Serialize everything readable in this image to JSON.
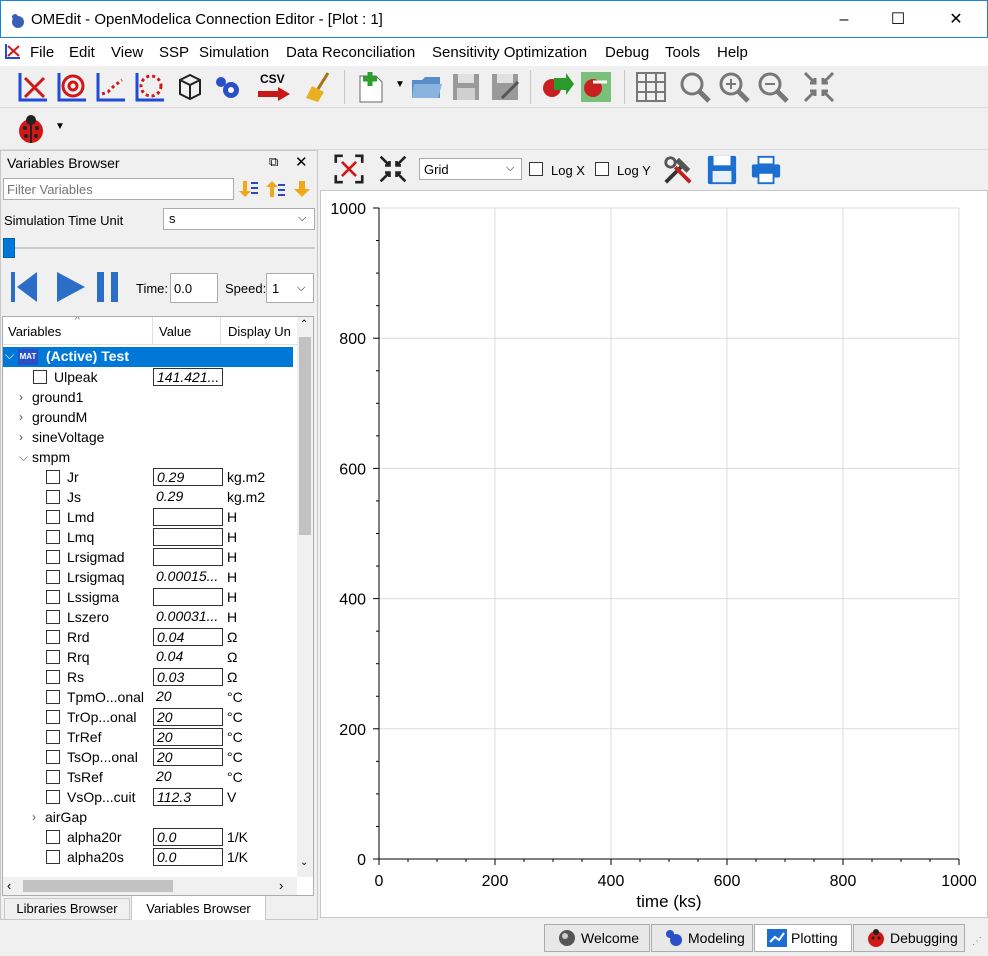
{
  "window": {
    "title": "OMEdit - OpenModelica Connection Editor - [Plot : 1]",
    "minimize": "–",
    "maximize": "☐",
    "close": "✕"
  },
  "menu": [
    "File",
    "Edit",
    "View",
    "SSP",
    "Simulation",
    "Data Reconciliation",
    "Sensitivity Optimization",
    "Debug",
    "Tools",
    "Help"
  ],
  "toolbar": {
    "csv_label": "CSV"
  },
  "variables_browser": {
    "title": "Variables Browser",
    "filter_placeholder": "Filter Variables",
    "sim_time_unit_label": "Simulation Time Unit",
    "sim_time_unit_value": "s",
    "time_label": "Time:",
    "time_value": "0.0",
    "speed_label": "Speed:",
    "speed_value": "1",
    "columns": [
      "Variables",
      "Value",
      "Display Un"
    ],
    "root": "(Active) Test",
    "root_badge": "MAT",
    "rows": [
      {
        "label": "Ulpeak",
        "value": "141.421...",
        "unit": "",
        "indent": 1,
        "type": "var",
        "boxed": true
      },
      {
        "label": "ground1",
        "indent": 1,
        "type": "group",
        "open": false
      },
      {
        "label": "groundM",
        "indent": 1,
        "type": "group",
        "open": false
      },
      {
        "label": "sineVoltage",
        "indent": 1,
        "type": "group",
        "open": false
      },
      {
        "label": "smpm",
        "indent": 1,
        "type": "group",
        "open": true
      },
      {
        "label": "Jr",
        "value": "0.29",
        "unit": "kg.m2",
        "indent": 2,
        "type": "var",
        "boxed": true
      },
      {
        "label": "Js",
        "value": "0.29",
        "unit": "kg.m2",
        "indent": 2,
        "type": "var",
        "boxed": false
      },
      {
        "label": "Lmd",
        "value": "",
        "unit": "H",
        "indent": 2,
        "type": "var",
        "boxed": true
      },
      {
        "label": "Lmq",
        "value": "",
        "unit": "H",
        "indent": 2,
        "type": "var",
        "boxed": true
      },
      {
        "label": "Lrsigmad",
        "value": "",
        "unit": "H",
        "indent": 2,
        "type": "var",
        "boxed": true
      },
      {
        "label": "Lrsigmaq",
        "value": "0.00015...",
        "unit": "H",
        "indent": 2,
        "type": "var",
        "boxed": false
      },
      {
        "label": "Lssigma",
        "value": "",
        "unit": "H",
        "indent": 2,
        "type": "var",
        "boxed": true
      },
      {
        "label": "Lszero",
        "value": "0.00031...",
        "unit": "H",
        "indent": 2,
        "type": "var",
        "boxed": false
      },
      {
        "label": "Rrd",
        "value": "0.04",
        "unit": "Ω",
        "indent": 2,
        "type": "var",
        "boxed": true
      },
      {
        "label": "Rrq",
        "value": "0.04",
        "unit": "Ω",
        "indent": 2,
        "type": "var",
        "boxed": false
      },
      {
        "label": "Rs",
        "value": "0.03",
        "unit": "Ω",
        "indent": 2,
        "type": "var",
        "boxed": true
      },
      {
        "label": "TpmO...onal",
        "value": "20",
        "unit": "°C",
        "indent": 2,
        "type": "var",
        "boxed": false
      },
      {
        "label": "TrOp...onal",
        "value": "20",
        "unit": "°C",
        "indent": 2,
        "type": "var",
        "boxed": true
      },
      {
        "label": "TrRef",
        "value": "20",
        "unit": "°C",
        "indent": 2,
        "type": "var",
        "boxed": true
      },
      {
        "label": "TsOp...onal",
        "value": "20",
        "unit": "°C",
        "indent": 2,
        "type": "var",
        "boxed": true
      },
      {
        "label": "TsRef",
        "value": "20",
        "unit": "°C",
        "indent": 2,
        "type": "var",
        "boxed": false
      },
      {
        "label": "VsOp...cuit",
        "value": "112.3",
        "unit": "V",
        "indent": 2,
        "type": "var",
        "boxed": true
      },
      {
        "label": "airGap",
        "indent": 2,
        "type": "group",
        "open": false
      },
      {
        "label": "alpha20r",
        "value": "0.0",
        "unit": "1/K",
        "indent": 2,
        "type": "var",
        "boxed": true
      },
      {
        "label": "alpha20s",
        "value": "0.0",
        "unit": "1/K",
        "indent": 2,
        "type": "var",
        "boxed": true
      }
    ]
  },
  "bottom_tabs_left": [
    "Libraries Browser",
    "Variables Browser"
  ],
  "plot_toolbar": {
    "grid_select": "Grid",
    "logx": "Log X",
    "logy": "Log Y"
  },
  "chart_data": {
    "type": "line",
    "series": [],
    "xlabel": "time (ks)",
    "ylabel": "",
    "xlim": [
      0,
      1000
    ],
    "ylim": [
      0,
      1000
    ],
    "xticks": [
      "0",
      "200",
      "400",
      "600",
      "800",
      "1000"
    ],
    "yticks": [
      "0",
      "200",
      "400",
      "600",
      "800",
      "1000"
    ],
    "grid": true
  },
  "perspectives": [
    "Welcome",
    "Modeling",
    "Plotting",
    "Debugging"
  ],
  "colors": {
    "accent": "#0078d7",
    "selection": "#0078d7",
    "grid": "#dcdcdc"
  }
}
